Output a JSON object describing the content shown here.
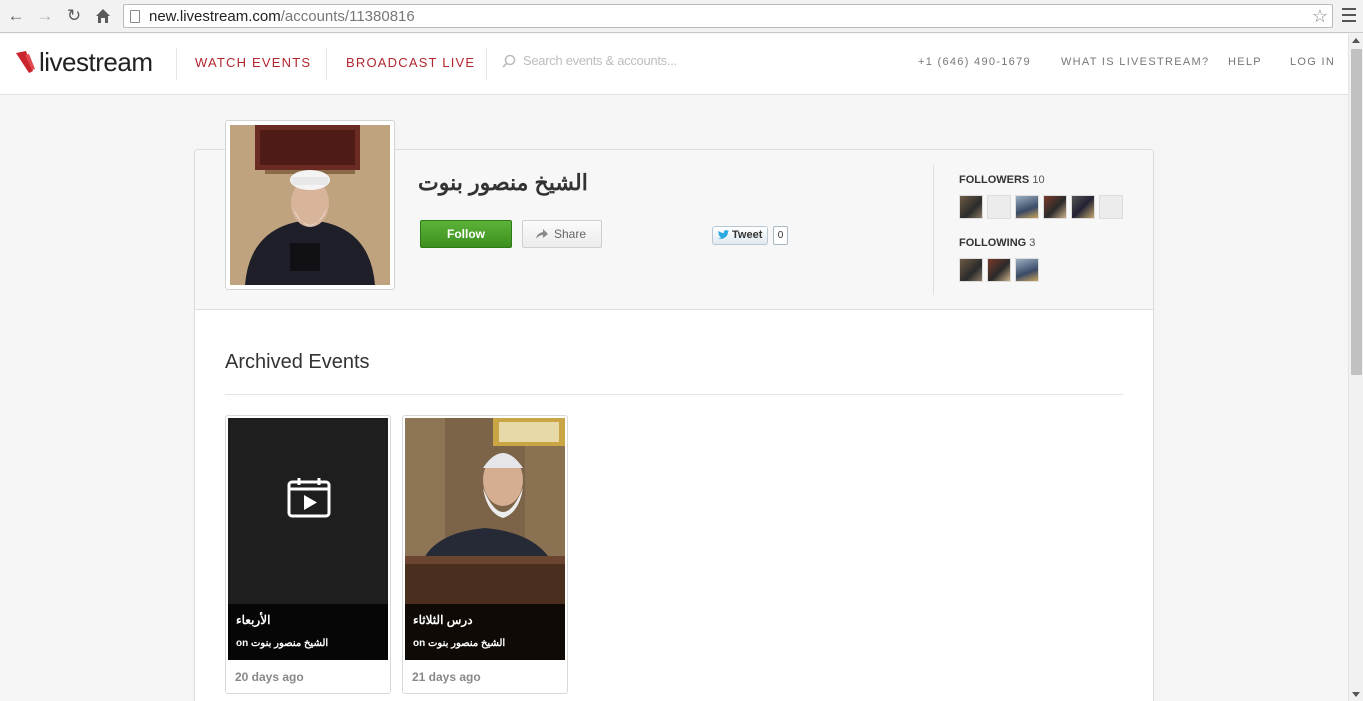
{
  "browser": {
    "url_host": "new.livestream.com",
    "url_path": "/accounts/11380816"
  },
  "header": {
    "logo_text": "livestream",
    "nav": [
      "WATCH EVENTS",
      "BROADCAST LIVE"
    ],
    "search_placeholder": "Search events & accounts...",
    "phone": "+1 (646) 490-1679",
    "links": [
      "WHAT IS LIVESTREAM?",
      "HELP",
      "LOG IN"
    ]
  },
  "colors": {
    "brand_red": "#b3262e",
    "follow_green": "#4aa12c"
  },
  "profile": {
    "name": "الشيخ منصور بنوت",
    "follow_label": "Follow",
    "share_label": "Share",
    "tweet_label": "Tweet",
    "tweet_count": "0",
    "followers_label": "FOLLOWERS",
    "followers_count": "10",
    "following_label": "FOLLOWING",
    "following_count": "3"
  },
  "archived": {
    "title": "Archived Events",
    "events": [
      {
        "title": "الأربعاء",
        "sub": "on الشيخ منصور بنوت",
        "ago": "20 days ago",
        "media_icon": "calendar-play-icon"
      },
      {
        "title": "درس الثلاثاء",
        "sub": "on الشيخ منصور بنوت",
        "ago": "21 days ago",
        "media_icon": "photo"
      }
    ]
  }
}
